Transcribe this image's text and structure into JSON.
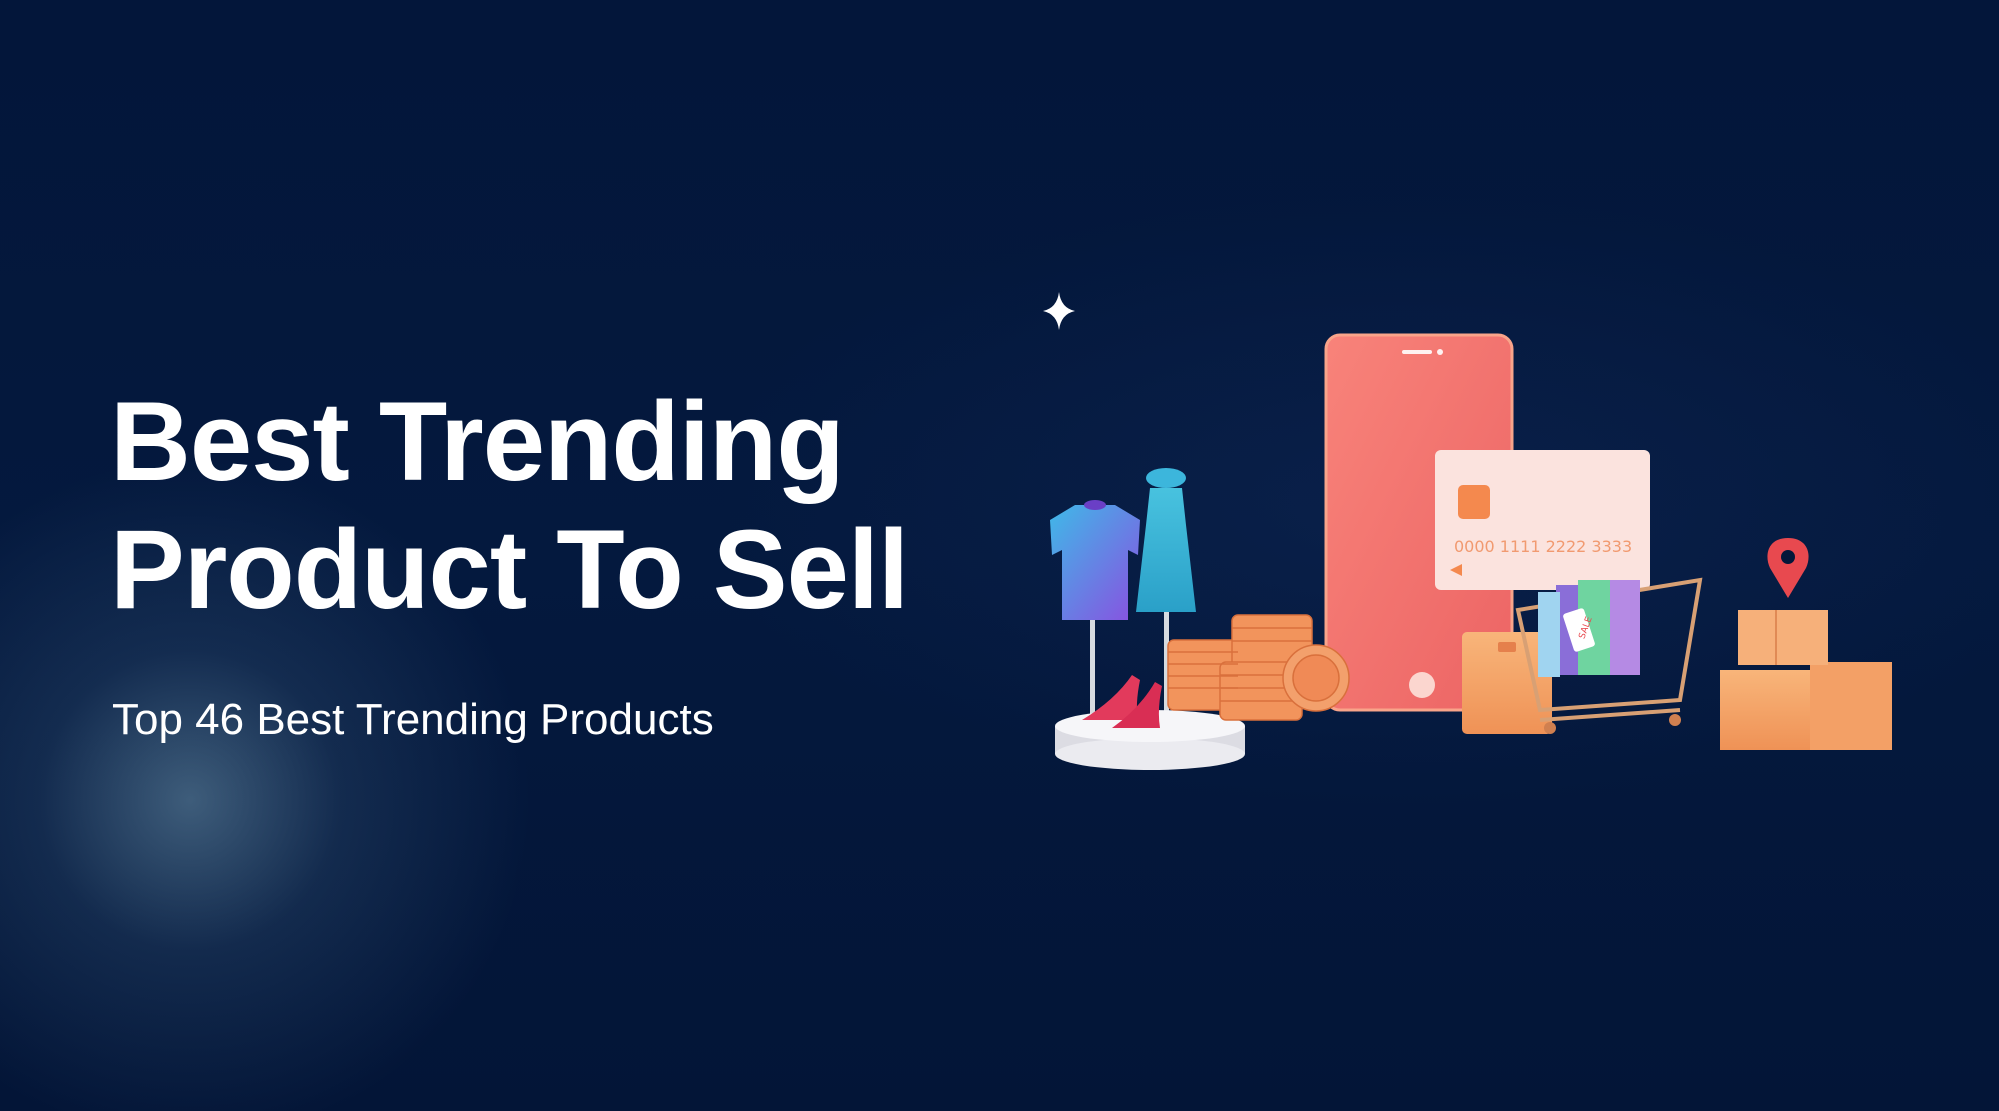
{
  "hero": {
    "title_line1": "Best Trending",
    "title_line2": "Product To Sell",
    "subtitle": "Top 46 Best Trending Products"
  },
  "illustration": {
    "card_number": "0000 1111 2222 3333",
    "sale_tag": "SALE",
    "icons": [
      "sparkle-icon",
      "map-pin-icon"
    ]
  },
  "colors": {
    "background": "#03173a",
    "phone": "#f4726a",
    "accent_orange": "#f5a05a",
    "pin": "#e8494f"
  }
}
